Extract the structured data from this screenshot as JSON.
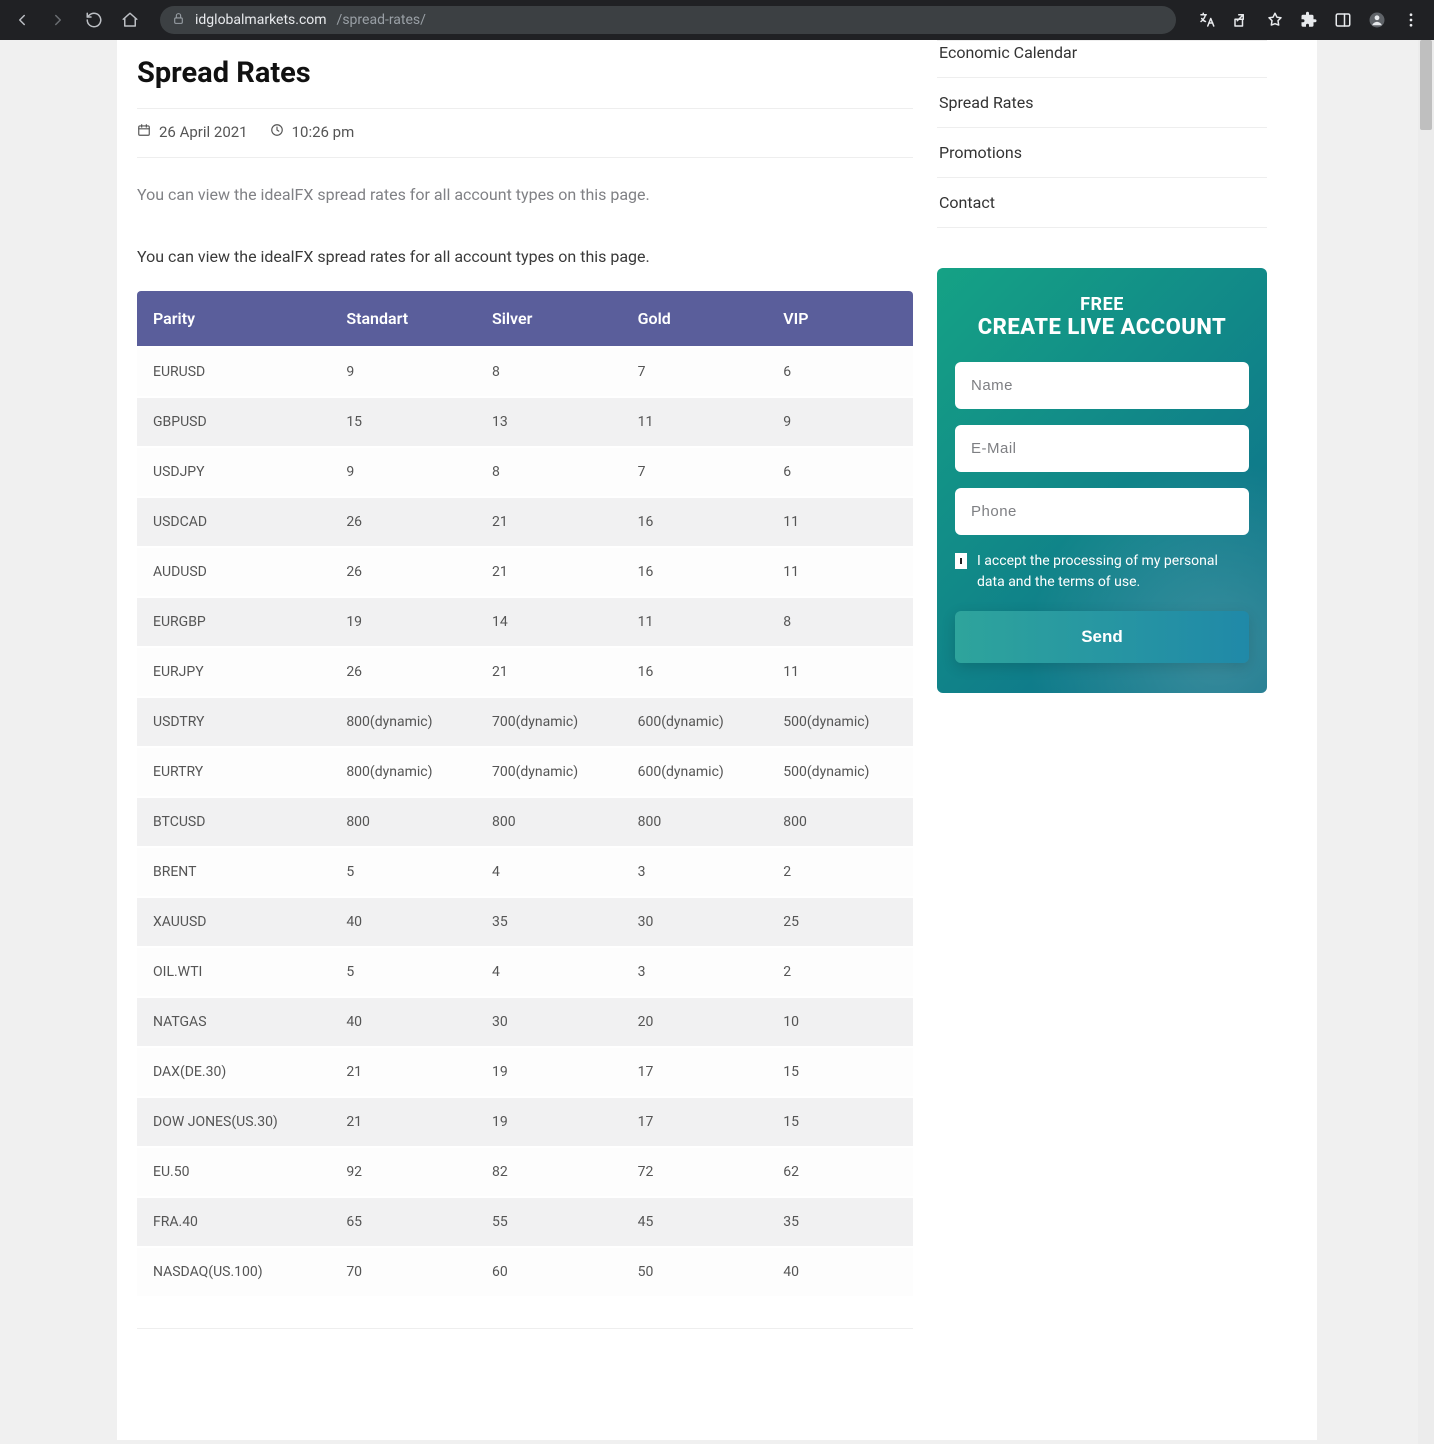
{
  "browser": {
    "url_host": "idglobalmarkets.com",
    "url_path": "/spread-rates/"
  },
  "page": {
    "title": "Spread Rates",
    "date": "26 April 2021",
    "time": "10:26 pm",
    "lead": "You can view the idealFX spread rates for all account types on this page.",
    "body_intro": "You can view the idealFX spread rates for all account types on this page."
  },
  "table": {
    "headers": [
      "Parity",
      "Standart",
      "Silver",
      "Gold",
      "VIP"
    ],
    "rows": [
      [
        "EURUSD",
        "9",
        "8",
        "7",
        "6"
      ],
      [
        "GBPUSD",
        "15",
        "13",
        "11",
        "9"
      ],
      [
        "USDJPY",
        "9",
        "8",
        "7",
        "6"
      ],
      [
        "USDCAD",
        "26",
        "21",
        "16",
        "11"
      ],
      [
        "AUDUSD",
        "26",
        "21",
        "16",
        "11"
      ],
      [
        "EURGBP",
        "19",
        "14",
        "11",
        "8"
      ],
      [
        "EURJPY",
        "26",
        "21",
        "16",
        "11"
      ],
      [
        "USDTRY",
        "800(dynamic)",
        "700(dynamic)",
        "600(dynamic)",
        "500(dynamic)"
      ],
      [
        "EURTRY",
        "800(dynamic)",
        "700(dynamic)",
        "600(dynamic)",
        "500(dynamic)"
      ],
      [
        "BTCUSD",
        "800",
        "800",
        "800",
        "800"
      ],
      [
        "BRENT",
        "5",
        "4",
        "3",
        "2"
      ],
      [
        "XAUUSD",
        "40",
        "35",
        "30",
        "25"
      ],
      [
        "OIL.WTI",
        "5",
        "4",
        "3",
        "2"
      ],
      [
        "NATGAS",
        "40",
        "30",
        "20",
        "10"
      ],
      [
        "DAX(DE.30)",
        "21",
        "19",
        "17",
        "15"
      ],
      [
        "DOW JONES(US.30)",
        "21",
        "19",
        "17",
        "15"
      ],
      [
        "EU.50",
        "92",
        "82",
        "72",
        "62"
      ],
      [
        "FRA.40",
        "65",
        "55",
        "45",
        "35"
      ],
      [
        "NASDAQ(US.100)",
        "70",
        "60",
        "50",
        "40"
      ]
    ]
  },
  "sidebar": {
    "items": [
      "Economic Calendar",
      "Spread Rates",
      "Promotions",
      "Contact"
    ]
  },
  "cta": {
    "free_label": "FREE",
    "title": "CREATE LIVE ACCOUNT",
    "name_placeholder": "Name",
    "email_placeholder": "E-Mail",
    "phone_placeholder": "Phone",
    "consent_text": "I accept the processing of my personal data and the terms of use.",
    "send_label": "Send"
  }
}
